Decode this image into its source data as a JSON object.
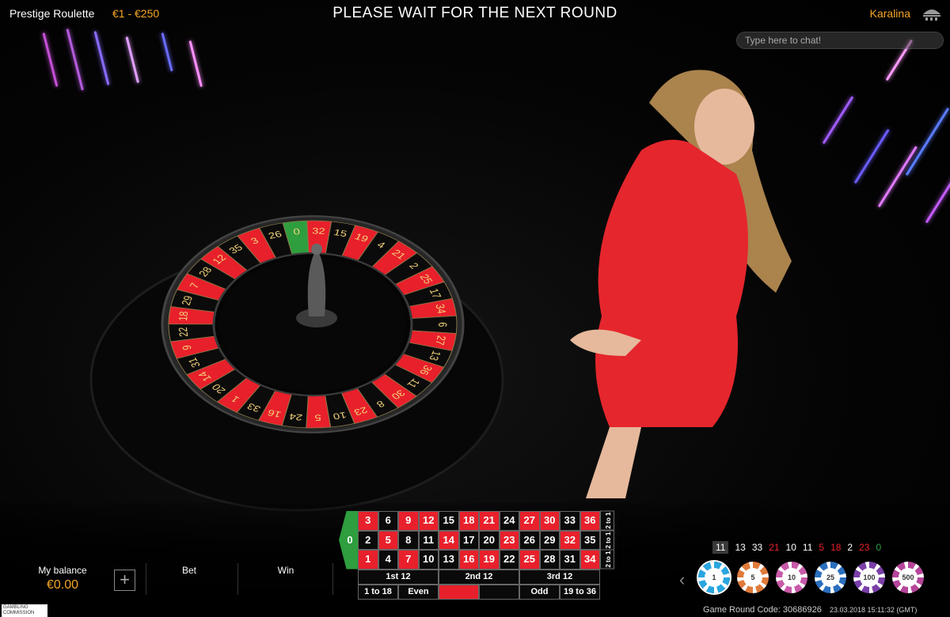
{
  "header": {
    "game_title": "Prestige Roulette",
    "bet_limits": "€1 - €250",
    "round_status": "PLEASE WAIT FOR THE NEXT ROUND",
    "dealer_name": "Karalina"
  },
  "chat": {
    "placeholder": "Type here to chat!"
  },
  "wheel": {
    "sequence": [
      "0",
      "32",
      "15",
      "19",
      "4",
      "21",
      "2",
      "25",
      "17",
      "34",
      "6",
      "27",
      "13",
      "36",
      "11",
      "30",
      "8",
      "23",
      "10",
      "5",
      "24",
      "16",
      "33",
      "1",
      "20",
      "14",
      "31",
      "9",
      "22",
      "18",
      "29",
      "7",
      "28",
      "12",
      "35",
      "3",
      "26"
    ]
  },
  "account": {
    "balance_label": "My balance",
    "balance_value": "€0.00",
    "add_symbol": "+",
    "bet_label": "Bet",
    "win_label": "Win"
  },
  "table": {
    "zero": "0",
    "rows": [
      [
        "3",
        "6",
        "9",
        "12",
        "15",
        "18",
        "21",
        "24",
        "27",
        "30",
        "33",
        "36"
      ],
      [
        "2",
        "5",
        "8",
        "11",
        "14",
        "17",
        "20",
        "23",
        "26",
        "29",
        "32",
        "35"
      ],
      [
        "1",
        "4",
        "7",
        "10",
        "13",
        "16",
        "19",
        "22",
        "25",
        "28",
        "31",
        "34"
      ]
    ],
    "red_numbers": [
      "1",
      "3",
      "5",
      "7",
      "9",
      "12",
      "14",
      "16",
      "18",
      "19",
      "21",
      "23",
      "25",
      "27",
      "30",
      "32",
      "34",
      "36"
    ],
    "column_bet": "2 to 1",
    "dozens": [
      "1st 12",
      "2nd 12",
      "3rd 12"
    ],
    "even_money": [
      "1 to 18",
      "Even",
      "",
      "Odd",
      "19 to 36"
    ]
  },
  "history": [
    {
      "n": "11",
      "c": "black"
    },
    {
      "n": "13",
      "c": "black"
    },
    {
      "n": "33",
      "c": "black"
    },
    {
      "n": "21",
      "c": "red"
    },
    {
      "n": "10",
      "c": "black"
    },
    {
      "n": "11",
      "c": "black"
    },
    {
      "n": "5",
      "c": "red"
    },
    {
      "n": "18",
      "c": "red"
    },
    {
      "n": "2",
      "c": "black"
    },
    {
      "n": "23",
      "c": "red"
    },
    {
      "n": "0",
      "c": "green"
    }
  ],
  "chips": [
    {
      "value": "1",
      "color": "#29a6e0"
    },
    {
      "value": "5",
      "color": "#e07a3a"
    },
    {
      "value": "10",
      "color": "#c85aa8"
    },
    {
      "value": "25",
      "color": "#2a6fbf"
    },
    {
      "value": "100",
      "color": "#7a3fa8"
    },
    {
      "value": "500",
      "color": "#b5459a"
    }
  ],
  "footer": {
    "regulator_logo": "GAMBLING COMMISSION",
    "round_code": "Game Round Code: 30686926",
    "timestamp": "23.03.2018 15:11:32 (GMT)"
  },
  "colors": {
    "accent": "#f5a623",
    "red": "#e8202b",
    "green": "#2e9e3e"
  },
  "icons": {
    "lobby": "lobby-icon",
    "chip_prev": "chevron-left-icon",
    "add": "plus-icon"
  }
}
